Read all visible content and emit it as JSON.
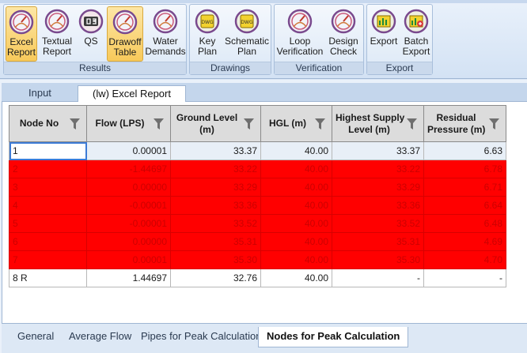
{
  "ribbon": {
    "groups": [
      {
        "label": "Results",
        "buttons": [
          {
            "label": "Excel\nReport"
          },
          {
            "label": "Textual\nReport"
          },
          {
            "label": "QS"
          },
          {
            "label": "Drawoff\nTable"
          },
          {
            "label": "Water\nDemands"
          }
        ]
      },
      {
        "label": "Drawings",
        "buttons": [
          {
            "label": "Key\nPlan"
          },
          {
            "label": "Schematic\nPlan"
          }
        ]
      },
      {
        "label": "Verification",
        "buttons": [
          {
            "label": "Loop\nVerification"
          },
          {
            "label": "Design\nCheck"
          }
        ]
      },
      {
        "label": "Export",
        "buttons": [
          {
            "label": "Export"
          },
          {
            "label": "Batch\nExport"
          }
        ]
      }
    ]
  },
  "tabs": [
    {
      "label": "Input"
    },
    {
      "label": "(lw) Excel Report"
    }
  ],
  "table": {
    "headers": [
      "Node No",
      "Flow (LPS)",
      "Ground Level\n(m)",
      "HGL (m)",
      "Highest Supply\nLevel (m)",
      "Residual\nPressure (m)"
    ],
    "rows": [
      {
        "cells": [
          "1",
          "0.00001",
          "33.37",
          "40.00",
          "33.37",
          "6.63"
        ]
      },
      {
        "cells": [
          "2",
          "-1.44697",
          "33.22",
          "40.00",
          "33.22",
          "6.78"
        ]
      },
      {
        "cells": [
          "3",
          "0.00000",
          "33.29",
          "40.00",
          "33.29",
          "6.71"
        ]
      },
      {
        "cells": [
          "4",
          "-0.00001",
          "33.36",
          "40.00",
          "33.36",
          "6.64"
        ]
      },
      {
        "cells": [
          "5",
          "-0.00001",
          "33.52",
          "40.00",
          "33.52",
          "6.48"
        ]
      },
      {
        "cells": [
          "6",
          "0.00000",
          "35.31",
          "40.00",
          "35.31",
          "4.69"
        ]
      },
      {
        "cells": [
          "7",
          "0.00001",
          "35.30",
          "40.00",
          "35.30",
          "4.70"
        ]
      },
      {
        "cells": [
          "8 R",
          "1.44697",
          "32.76",
          "40.00",
          "-",
          "-"
        ]
      }
    ]
  },
  "bottom_tabs": [
    {
      "label": "General"
    },
    {
      "label": "Average Flow"
    },
    {
      "label": "Pipes for Peak Calculation"
    },
    {
      "label": "Nodes for Peak Calculation"
    }
  ],
  "colors": {
    "alarm_row": "#ff0000",
    "alarm_text": "#cc0000",
    "selection": "#3d7bd6"
  }
}
